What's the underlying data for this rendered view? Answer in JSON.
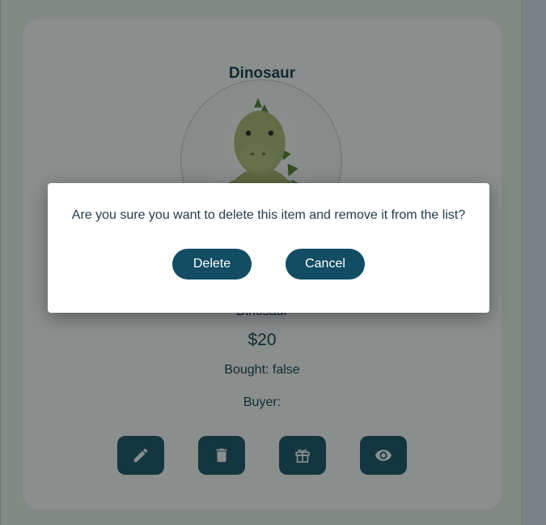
{
  "item": {
    "title": "Dinosaur",
    "photo_alt": "plush-dinosaur",
    "description": "Dinosaur",
    "price": "$20",
    "bought": "Bought: false",
    "buyer": "Buyer:"
  },
  "actions": [
    {
      "icon": "pencil-icon"
    },
    {
      "icon": "trash-icon"
    },
    {
      "icon": "gift-icon"
    },
    {
      "icon": "eye-icon"
    }
  ],
  "dialog": {
    "message": "Are you sure you want to delete this item and remove it from the list?",
    "delete_label": "Delete",
    "cancel_label": "Cancel"
  },
  "colors": {
    "primary": "#124d63",
    "text": "#0f3347",
    "background": "#eef3ec",
    "card": "#ffffff"
  }
}
